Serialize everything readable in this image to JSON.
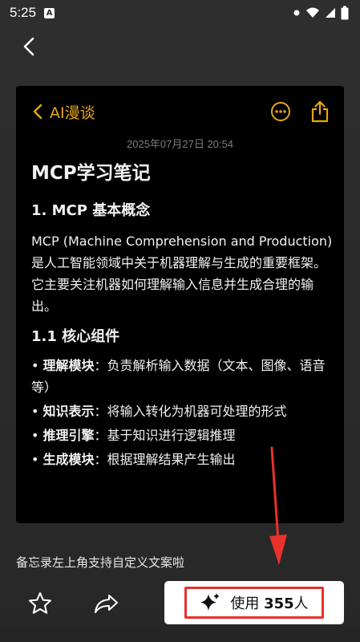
{
  "status": {
    "time": "5:25",
    "notification_badge": "A"
  },
  "card": {
    "back_label": "AI漫谈",
    "date": "2025年07月27日 20:54",
    "accent_color": "#e9a714"
  },
  "note": {
    "title": "MCP学习笔记",
    "section1_heading": "1. MCP 基本概念",
    "paragraph": "MCP (Machine Comprehension and Production) 是人工智能领域中关于机器理解与生成的重要框架。它主要关注机器如何理解输入信息并生成合理的输出。",
    "section2_heading": "1.1 核心组件",
    "bullets": [
      {
        "term": "理解模块",
        "desc": "：负责解析输入数据（文本、图像、语音等）"
      },
      {
        "term": "知识表示",
        "desc": "：将输入转化为机器可处理的形式"
      },
      {
        "term": "推理引擎",
        "desc": "：基于知识进行逻辑推理"
      },
      {
        "term": "生成模块",
        "desc": "：根据理解结果产生输出"
      }
    ]
  },
  "caption": "备忘录左上角支持自定义文案啦",
  "bottom": {
    "use_prefix": "使用 ",
    "use_count": "355",
    "use_suffix": "人",
    "highlight_color": "#e8322b"
  }
}
